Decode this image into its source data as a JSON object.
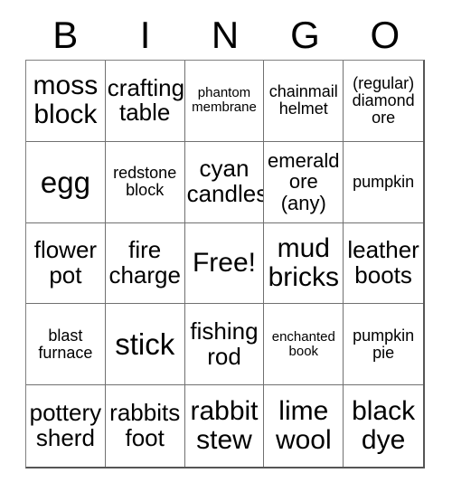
{
  "card": {
    "type": "bingo-card",
    "header_letters": [
      "B",
      "I",
      "N",
      "G",
      "O"
    ],
    "columns": 5,
    "rows": 5,
    "free_space_label": "Free!",
    "free_space_position": {
      "row": 3,
      "column": 3
    },
    "colors": {
      "background": "#ffffff",
      "text": "#000000",
      "grid_line": "#707070",
      "outer_border": "#555555"
    },
    "rows_data": [
      {
        "cells": [
          {
            "text": "moss block",
            "size": "xl"
          },
          {
            "text": "crafting table",
            "size": "lg"
          },
          {
            "text": "phantom membrane",
            "size": "xs"
          },
          {
            "text": "chainmail helmet",
            "size": "sm"
          },
          {
            "text": "(regular) diamond ore",
            "size": "sm"
          }
        ]
      },
      {
        "cells": [
          {
            "text": "egg",
            "size": "xxl"
          },
          {
            "text": "redstone block",
            "size": "sm"
          },
          {
            "text": "cyan candles",
            "size": "lg"
          },
          {
            "text": "emerald ore (any)",
            "size": "md"
          },
          {
            "text": "pumpkin",
            "size": "sm"
          }
        ]
      },
      {
        "cells": [
          {
            "text": "flower pot",
            "size": "lg"
          },
          {
            "text": "fire charge",
            "size": "lg"
          },
          {
            "text": "Free!",
            "size": "xl"
          },
          {
            "text": "mud bricks",
            "size": "xl"
          },
          {
            "text": "leather boots",
            "size": "lg"
          }
        ]
      },
      {
        "cells": [
          {
            "text": "blast furnace",
            "size": "sm"
          },
          {
            "text": "stick",
            "size": "xxl"
          },
          {
            "text": "fishing rod",
            "size": "lg"
          },
          {
            "text": "enchanted book",
            "size": "xs"
          },
          {
            "text": "pumpkin pie",
            "size": "sm"
          }
        ]
      },
      {
        "cells": [
          {
            "text": "pottery sherd",
            "size": "lg"
          },
          {
            "text": "rabbits foot",
            "size": "lg"
          },
          {
            "text": "rabbit stew",
            "size": "xl"
          },
          {
            "text": "lime wool",
            "size": "xl"
          },
          {
            "text": "black dye",
            "size": "xl"
          }
        ]
      }
    ]
  }
}
